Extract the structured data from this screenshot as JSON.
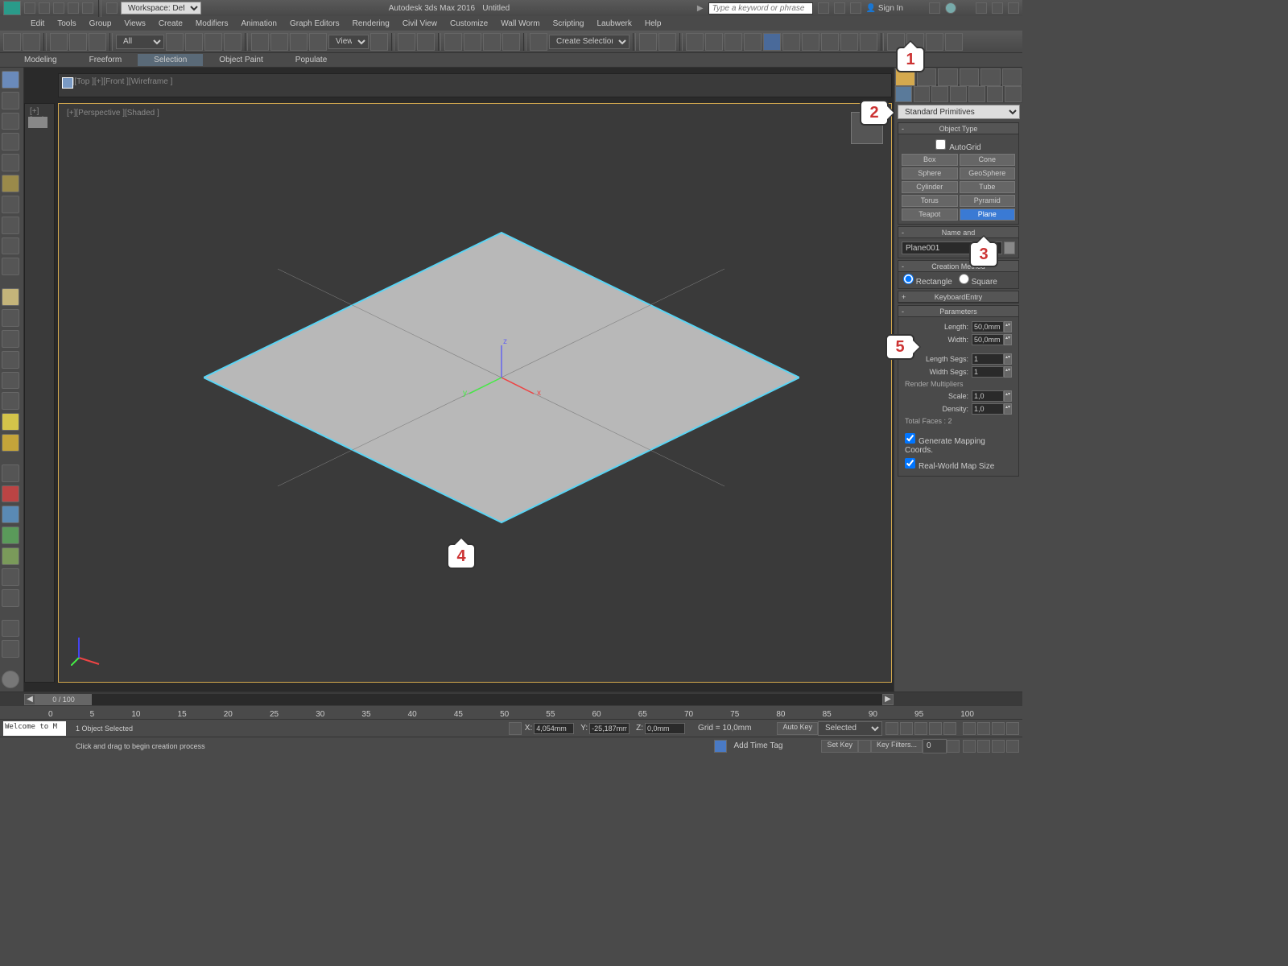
{
  "title": {
    "app": "Autodesk 3ds Max 2016",
    "doc": "Untitled",
    "search_placeholder": "Type a keyword or phrase",
    "signin": "Sign In",
    "workspace_label": "Workspace: Default"
  },
  "menu": [
    "Edit",
    "Tools",
    "Group",
    "Views",
    "Create",
    "Modifiers",
    "Animation",
    "Graph Editors",
    "Rendering",
    "Civil View",
    "Customize",
    "Wall Worm",
    "Scripting",
    "Laubwerk",
    "Help"
  ],
  "ribbon": {
    "items": [
      "Modeling",
      "Freeform",
      "Selection",
      "Object Paint",
      "Populate"
    ],
    "active": "Selection"
  },
  "toolbar": {
    "selset_placeholder": "Create Selection Se",
    "filter": "All",
    "view_label": "View"
  },
  "vp": {
    "top": "[+][Top ][+][Front ][Wireframe ]",
    "left": "[+][Lef",
    "main": "[+][Perspective ][Shaded ]"
  },
  "cmd": {
    "category": "Standard Primitives",
    "obj_type_hdr": "Object Type",
    "autogrid": "AutoGrid",
    "primitives": [
      [
        "Box",
        "Cone"
      ],
      [
        "Sphere",
        "GeoSphere"
      ],
      [
        "Cylinder",
        "Tube"
      ],
      [
        "Torus",
        "Pyramid"
      ],
      [
        "Teapot",
        "Plane"
      ]
    ],
    "active_prim": "Plane",
    "name_hdr": "Name and",
    "obj_name": "Plane001",
    "creation_hdr": "Creation Method",
    "creation": {
      "rect": "Rectangle",
      "sq": "Square"
    },
    "kbentry_hdr": "KeyboardEntry",
    "params_hdr": "Parameters",
    "params": {
      "length_lbl": "Length:",
      "length": "50,0mm",
      "width_lbl": "Width:",
      "width": "50,0mm",
      "lsegs_lbl": "Length Segs:",
      "lsegs": "1",
      "wsegs_lbl": "Width Segs:",
      "wsegs": "1"
    },
    "render_mult": "Render Multipliers",
    "scale_lbl": "Scale:",
    "scale": "1,0",
    "density_lbl": "Density:",
    "density": "1,0",
    "faces": "Total Faces : 2",
    "gen_map": "Generate Mapping Coords.",
    "rw_map": "Real-World Map Size"
  },
  "time": {
    "frame": "0 / 100",
    "ticks": [
      "0",
      "5",
      "10",
      "15",
      "20",
      "25",
      "30",
      "35",
      "40",
      "45",
      "50",
      "55",
      "60",
      "65",
      "70",
      "75",
      "80",
      "85",
      "90",
      "95",
      "100"
    ]
  },
  "status": {
    "welcome": "Welcome to M",
    "sel": "1 Object Selected",
    "hint": "Click and drag to begin creation process",
    "x": "4,054mm",
    "y": "-25,187mm",
    "z": "0,0mm",
    "grid": "Grid = 10,0mm",
    "addtag": "Add Time Tag",
    "autokey": "Auto Key",
    "setkey": "Set Key",
    "selected": "Selected",
    "keyfilters": "Key Filters..."
  },
  "callouts": {
    "1": "1",
    "2": "2",
    "3": "3",
    "4": "4",
    "5": "5"
  }
}
